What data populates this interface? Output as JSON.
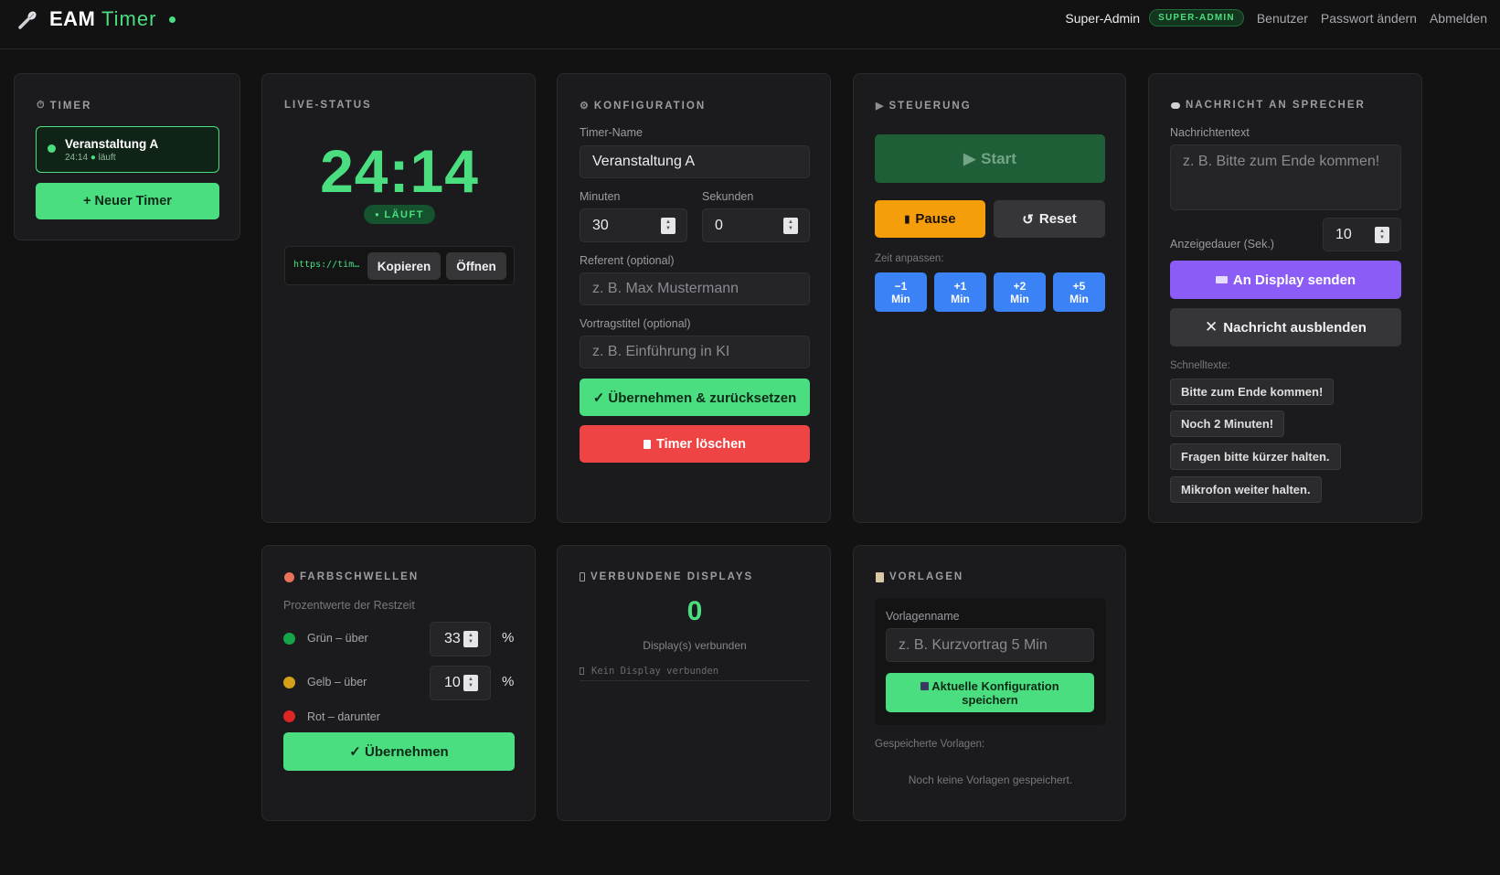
{
  "header": {
    "brand_main": "EAM",
    "brand_accent": "Timer",
    "user_name": "Super-Admin",
    "role_badge": "SUPER-ADMIN",
    "nav": {
      "users": "Benutzer",
      "change_password": "Passwort ändern",
      "logout": "Abmelden"
    }
  },
  "timer_panel": {
    "title": "TIMER",
    "icon": "stopwatch-icon",
    "item": {
      "name": "Veranstaltung A",
      "time": "24:14",
      "status": "läuft"
    },
    "new_timer_label": "+ Neuer Timer"
  },
  "live_status": {
    "title": "LIVE-STATUS",
    "time": "24:14",
    "badge": "LÄUFT",
    "url": "https://tim…",
    "copy_label": "Kopieren",
    "open_label": "Öffnen"
  },
  "config": {
    "title": "KONFIGURATION",
    "icon": "gear-icon",
    "name_label": "Timer-Name",
    "name_value": "Veranstaltung A",
    "minutes_label": "Minuten",
    "minutes_value": "30",
    "seconds_label": "Sekunden",
    "seconds_value": "0",
    "speaker_label": "Referent (optional)",
    "speaker_placeholder": "z. B. Max Mustermann",
    "talk_label": "Vortragstitel (optional)",
    "talk_placeholder": "z. B. Einführung in KI",
    "apply_label": "✓ Übernehmen & zurücksetzen",
    "delete_label": "Timer löschen"
  },
  "control": {
    "title": "STEUERUNG",
    "start_label": "Start",
    "pause_label": "Pause",
    "reset_label": "Reset",
    "adjust_label": "Zeit anpassen:",
    "adjust_buttons": [
      {
        "top": "−1",
        "bottom": "Min"
      },
      {
        "top": "+1",
        "bottom": "Min"
      },
      {
        "top": "+2",
        "bottom": "Min"
      },
      {
        "top": "+5",
        "bottom": "Min"
      }
    ]
  },
  "message": {
    "title": "NACHRICHT AN SPRECHER",
    "icon": "speech-bubble-icon",
    "text_label": "Nachrichtentext",
    "text_placeholder": "z. B. Bitte zum Ende kommen!",
    "duration_label": "Anzeigedauer (Sek.)",
    "duration_value": "10",
    "send_label": "An Display senden",
    "hide_label": "Nachricht ausblenden",
    "quick_label": "Schnelltexte:",
    "quick_texts": [
      "Bitte zum Ende kommen!",
      "Noch 2 Minuten!",
      "Fragen bitte kürzer halten.",
      "Mikrofon weiter halten."
    ]
  },
  "thresholds": {
    "title": "FARBSCHWELLEN",
    "icon": "palette-icon",
    "subtitle": "Prozentwerte der Restzeit",
    "green_label": "Grün – über",
    "green_value": "33",
    "yellow_label": "Gelb – über",
    "yellow_value": "10",
    "red_label": "Rot – darunter",
    "percent": "%",
    "apply_label": "✓ Übernehmen",
    "colors": {
      "green": "#16a34a",
      "yellow": "#d4a017",
      "red": "#dc2626"
    }
  },
  "displays": {
    "title": "VERBUNDENE DISPLAYS",
    "icon": "display-icon",
    "count": "0",
    "count_label": "Display(s) verbunden",
    "empty": "Kein Display verbunden"
  },
  "templates": {
    "title": "VORLAGEN",
    "icon": "clipboard-icon",
    "name_label": "Vorlagenname",
    "name_placeholder": "z. B. Kurzvortrag 5 Min",
    "save_label_1": "Aktuelle Konfiguration",
    "save_label_2": "speichern",
    "saved_label": "Gespeicherte Vorlagen:",
    "empty": "Noch keine Vorlagen gespeichert."
  }
}
